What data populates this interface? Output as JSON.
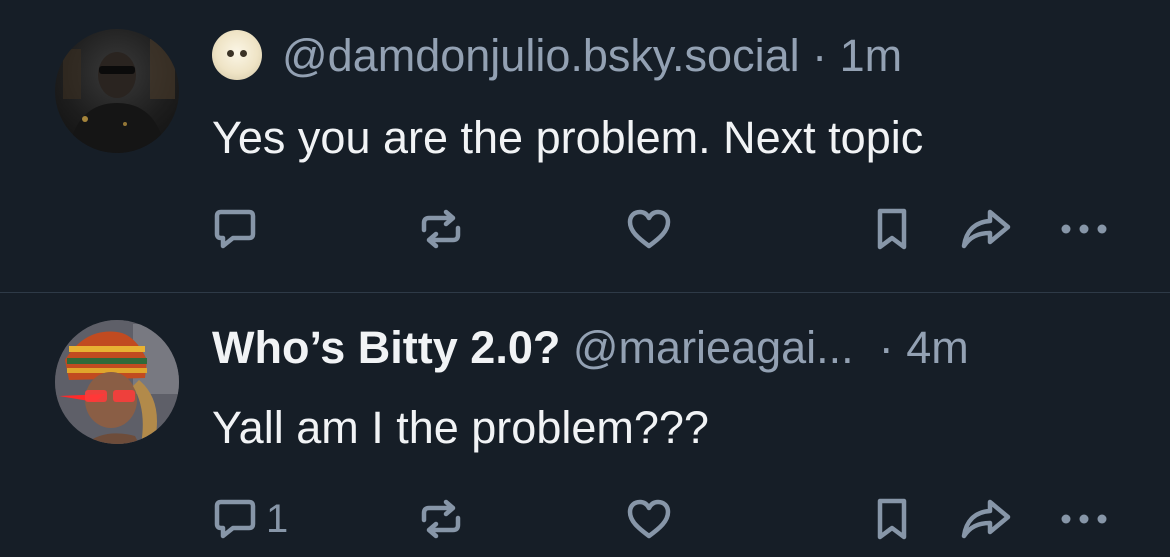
{
  "posts": [
    {
      "handle": "@damdonjulio.bsky.social",
      "separator": "·",
      "time": "1m",
      "text": "Yes you are the problem. Next topic",
      "reply_count": ""
    },
    {
      "display_name": "Who’s Bitty 2.0?",
      "handle": "@marieagai...",
      "separator": "·",
      "time": "4m",
      "text": "Yall am I the problem???",
      "reply_count": "1"
    }
  ],
  "colors": {
    "background": "#161e27",
    "text": "#f1f3f5",
    "muted": "#93a1b3",
    "divider": "#2e3a47"
  }
}
